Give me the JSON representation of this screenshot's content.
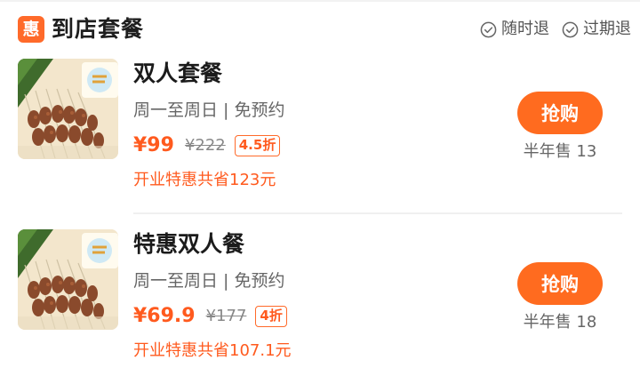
{
  "header": {
    "badge": "惠",
    "title": "到店套餐",
    "guarantees": [
      "随时退",
      "过期退"
    ]
  },
  "deals": [
    {
      "name": "双人套餐",
      "note": "周一至周日 | 免预约",
      "price": "¥99",
      "original_price": "¥222",
      "discount": "4.5折",
      "saving": "开业特惠共省123元",
      "button": "抢购",
      "sales": "半年售 13"
    },
    {
      "name": "特惠双人餐",
      "note": "周一至周日 | 免预约",
      "price": "¥69.9",
      "original_price": "¥177",
      "discount": "4折",
      "saving": "开业特惠共省107.1元",
      "button": "抢购",
      "sales": "半年售 18"
    }
  ],
  "colors": {
    "accent": "#ff6b1f",
    "price": "#ff5a1e"
  },
  "icons": [
    "check-circle-icon"
  ]
}
